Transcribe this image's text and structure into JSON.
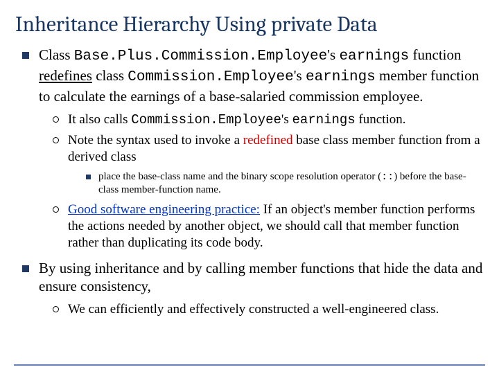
{
  "title": "Inheritance Hierarchy Using private Data",
  "b1": {
    "pre": "Class ",
    "code1": "Base.Plus.Commission.Employee",
    "mid1": "'s ",
    "code2": "earnings",
    "mid2": " function ",
    "redef": "redefines",
    "mid3": " class ",
    "code3": "Commission.Employee",
    "mid4": "'s ",
    "code4": "earnings",
    "post": " member function to calculate the earnings of a base-salaried commission employee."
  },
  "b1s1": {
    "pre": "It also calls ",
    "code1": "Commission.Employee",
    "mid1": "'s ",
    "code2": "earnings",
    "post": " function."
  },
  "b1s2": {
    "pre": "Note the syntax used to invoke a ",
    "red": "redefined",
    "post": " base class member function from a derived class"
  },
  "b1s2s1": {
    "pre": "place the base-class name and the binary scope resolution operator (",
    "op": "::",
    "post": ") before the base-class member-function name."
  },
  "b1s3": {
    "blue": "Good software engineering practice:",
    "rest": " If an object's member function performs the actions needed by another object, we should call that member function rather than duplicating its code body."
  },
  "b2": {
    "text": "By using inheritance and by calling member functions that hide the data and ensure consistency,"
  },
  "b2s1": {
    "text": "We can efficiently and effectively constructed a well-engineered class."
  }
}
